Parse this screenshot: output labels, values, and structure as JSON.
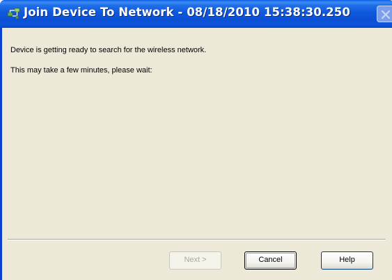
{
  "window": {
    "title": "Join Device To Network - 08/18/2010 15:38:30.250",
    "title_icon": "network-device-icon",
    "close_icon": "close-icon"
  },
  "content": {
    "message_1": "Device is getting ready to search for the wireless network.",
    "message_2": "This may take a few minutes, please wait:"
  },
  "buttons": {
    "next_label": "Next >",
    "next_enabled": false,
    "cancel_label": "Cancel",
    "help_label": "Help"
  },
  "colors": {
    "titlebar": "#0b4fd4",
    "dialog_face": "#ece9d8",
    "disabled_text": "#aca899"
  }
}
